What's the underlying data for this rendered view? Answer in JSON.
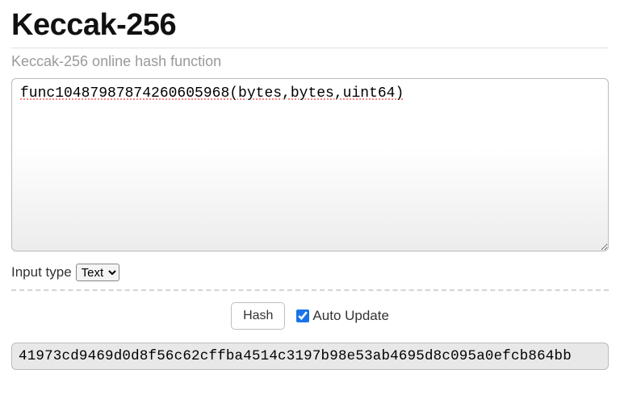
{
  "page": {
    "title": "Keccak-256",
    "subtitle": "Keccak-256 online hash function"
  },
  "input": {
    "value": "func10487987874260605968(bytes,bytes,uint64)"
  },
  "inputType": {
    "label": "Input type",
    "selected": "Text",
    "options": [
      "Text"
    ]
  },
  "controls": {
    "hash_label": "Hash",
    "auto_update_label": "Auto Update",
    "auto_update_checked": true
  },
  "output": {
    "value": "41973cd9469d0d8f56c62cffba4514c3197b98e53ab4695d8c095a0efcb864bb"
  }
}
